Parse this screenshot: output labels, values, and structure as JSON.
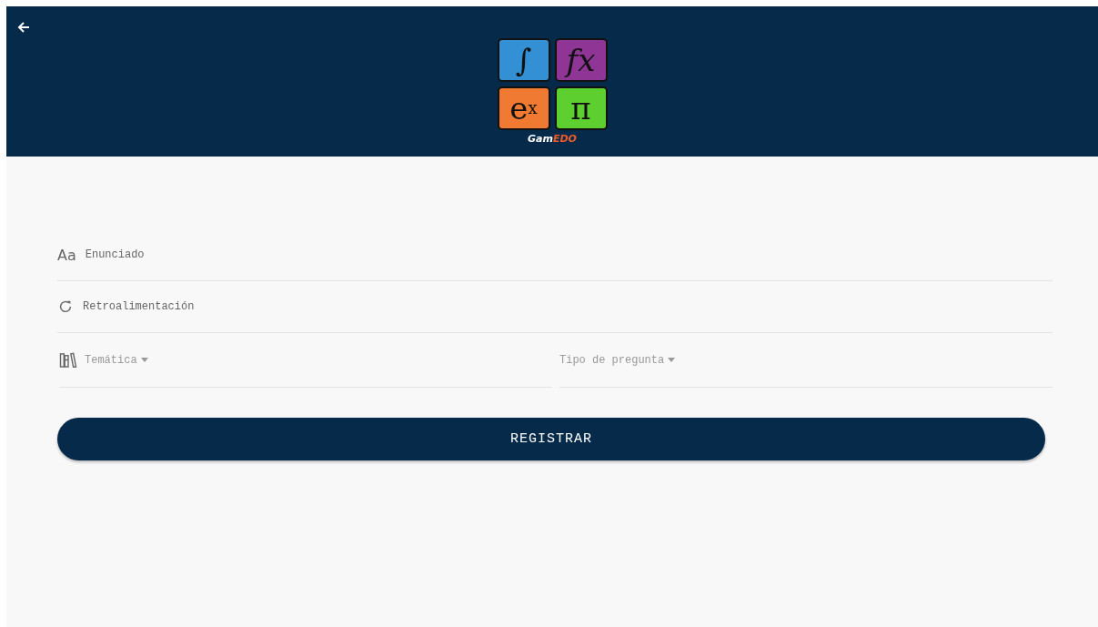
{
  "header": {
    "logo": {
      "tiles": [
        {
          "symbol": "∫",
          "color": "#3390d4"
        },
        {
          "symbol": "fx",
          "color": "#8e3596"
        },
        {
          "symbol": "e$^{x}$",
          "color": "#f07a32"
        },
        {
          "symbol": "π",
          "color": "#5dcf2e"
        }
      ],
      "name": [
        {
          "text": "Gam",
          "color": "#ffffff"
        },
        {
          "text": "EDO",
          "color": "#f05a28"
        }
      ]
    }
  },
  "fields": [
    {
      "kind": "text",
      "icon_text": "Aa",
      "placeholder": "Enunciado"
    },
    {
      "kind": "text",
      "placeholder": "Retroalimentación"
    }
  ],
  "selects": [
    {
      "placeholder": "Temática"
    },
    {
      "placeholder": "Tipo de pregunta"
    }
  ],
  "submit": {
    "label": "REGISTRAR"
  }
}
